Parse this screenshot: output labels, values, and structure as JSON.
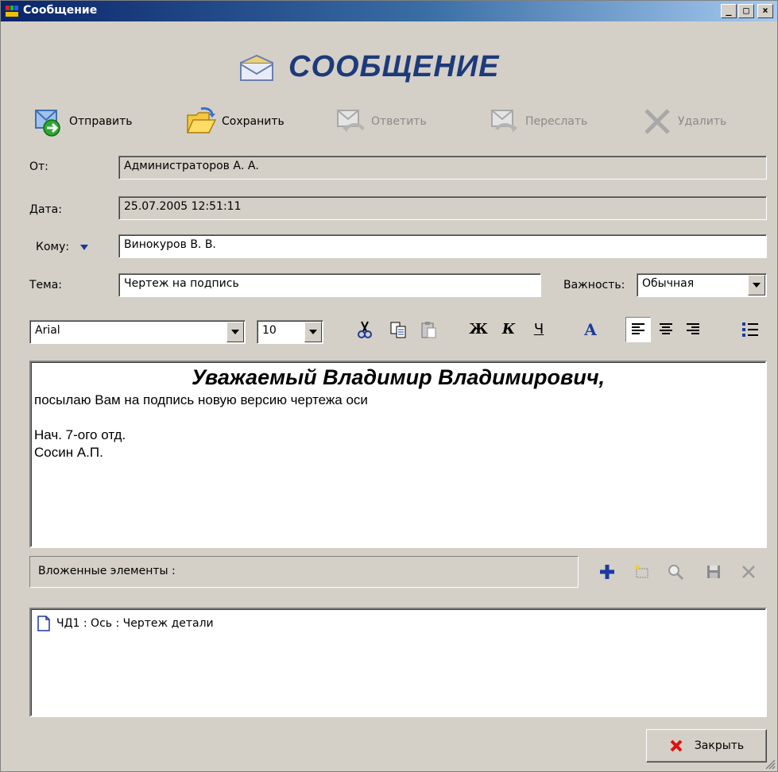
{
  "window": {
    "title": "Сообщение"
  },
  "header": {
    "title": "СООБЩЕНИЕ"
  },
  "toolbar": {
    "send": "Отправить",
    "save": "Сохранить",
    "reply": "Ответить",
    "forward": "Переслать",
    "delete": "Удалить"
  },
  "fields": {
    "from_label": "От:",
    "from_value": "Администраторов А. А.",
    "date_label": "Дата:",
    "date_value": "25.07.2005 12:51:11",
    "to_label": "Кому:",
    "to_value": "Винокуров В. В.",
    "subject_label": "Тема:",
    "subject_value": "Чертеж на подпись",
    "importance_label": "Важность:",
    "importance_value": "Обычная"
  },
  "format": {
    "font": "Arial",
    "size": "10",
    "bold": "Ж",
    "italic": "К",
    "underline": "Ч",
    "color": "A"
  },
  "body": {
    "greeting": "Уважаемый Владимир Владимирович,",
    "line1": "посылаю Вам на подпись новую версию чертежа оси",
    "line2": "",
    "line3": "Нач. 7-ого отд.",
    "line4": "Сосин А.П."
  },
  "attachments": {
    "label": "Вложенные элементы :",
    "items": [
      "ЧД1 : Ось : Чертеж детали"
    ]
  },
  "footer": {
    "close": "Закрыть"
  },
  "colors": {
    "title_blue": "#1d3a7a",
    "titlebar_start": "#0a246a",
    "close_red": "#e01010"
  }
}
